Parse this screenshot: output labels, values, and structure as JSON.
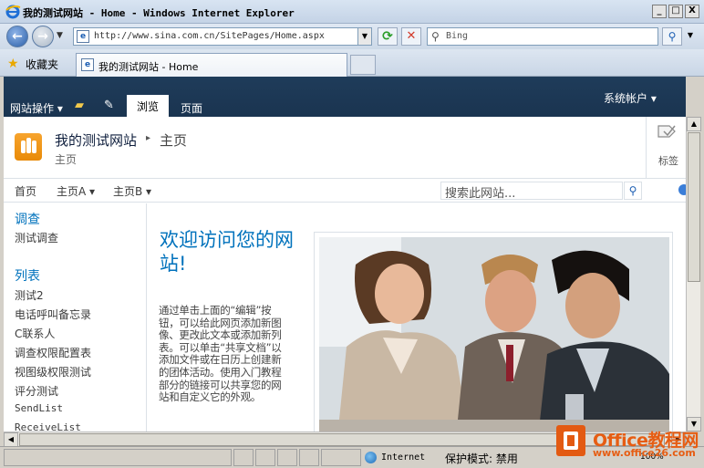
{
  "window": {
    "title": "我的测试网站 - Home - Windows Internet Explorer",
    "minimize": "_",
    "maximize": "□",
    "close": "X"
  },
  "browser": {
    "url": "http://www.sina.com.cn/SitePages/Home.aspx",
    "search_placeholder": "Bing",
    "favorites_label": "收藏夹",
    "tab_label": "我的测试网站 - Home"
  },
  "ribbon": {
    "site_actions": "网站操作 ▾",
    "tab_browse": "浏览",
    "tab_page": "页面",
    "account": "系统帐户 ▾"
  },
  "title_area": {
    "site_name": "我的测试网站",
    "breadcrumb_page": "主页",
    "subtitle": "主页",
    "tags_label": "标签"
  },
  "top_nav": {
    "items": [
      "首页",
      "主页A ▾",
      "主页B ▾"
    ],
    "search_placeholder": "搜索此网站..."
  },
  "quick_launch": {
    "survey_heading": "调查",
    "survey_items": [
      "测试调查"
    ],
    "lists_heading": "列表",
    "list_items": [
      "测试2",
      "电话呼叫备忘录",
      "C联系人",
      "调查权限配置表",
      "视图级权限测试",
      "评分测试",
      "SendList",
      "ReceiveList"
    ]
  },
  "main": {
    "welcome": "欢迎访问您的网站!",
    "body": "通过单击上面的“编辑”按钮，可以给此网页添加新图像、更改此文本或添加新列表。可以单击“共享文档”以添加文件或在日历上创建新的团体活动。使用入门教程部分的链接可以共享您的网站和自定义它的外观。"
  },
  "status": {
    "zone": "Internet",
    "protected_mode": "保护模式: 禁用",
    "zoom": "100%"
  },
  "watermark": {
    "title": "Office教程网",
    "url": "www.office26.com"
  },
  "colors": {
    "ribbon_bg": "#1f3c5a",
    "accent_link": "#0072bc",
    "logo_orange": "#f39c1f",
    "watermark_orange": "#e65d13"
  }
}
